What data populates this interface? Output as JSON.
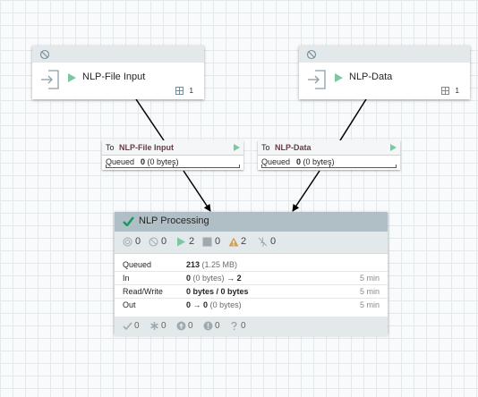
{
  "groups": [
    {
      "name": "NLP-File Input",
      "count": "1"
    },
    {
      "name": "NLP-Data",
      "count": "1"
    }
  ],
  "connections": [
    {
      "to_label": "To",
      "destination": "NLP-File Input",
      "queued_label": "Queued",
      "queued_count": "0",
      "queued_size": "(0 bytes)"
    },
    {
      "to_label": "To",
      "destination": "NLP-Data",
      "queued_label": "Queued",
      "queued_count": "0",
      "queued_size": "(0 bytes)"
    }
  ],
  "processor": {
    "name": "NLP Processing",
    "stats": {
      "transmitting": "0",
      "not_transmitting": "0",
      "running": "2",
      "stopped": "0",
      "invalid": "2",
      "disabled": "0"
    },
    "rows": {
      "queued": {
        "label": "Queued",
        "count": "213",
        "size": "(1.25 MB)"
      },
      "in": {
        "label": "In",
        "count": "0",
        "size": "(0 bytes)",
        "arrow": "→",
        "ports": "2",
        "window": "5 min"
      },
      "rw": {
        "label": "Read/Write",
        "value": "0 bytes / 0 bytes",
        "window": "5 min"
      },
      "out": {
        "label": "Out",
        "count": "0",
        "arrow": "→",
        "ports": "0",
        "size": "(0 bytes)",
        "window": "5 min"
      }
    },
    "footer": {
      "up_to_date": "0",
      "locally_modified": "0",
      "stale": "0",
      "errors": "0",
      "unknown": "0"
    }
  },
  "colors": {
    "accent_green": "#7dc7a0",
    "warning": "#cf9f5d",
    "header": "#b0bec5",
    "destination": "#6a3c42"
  }
}
